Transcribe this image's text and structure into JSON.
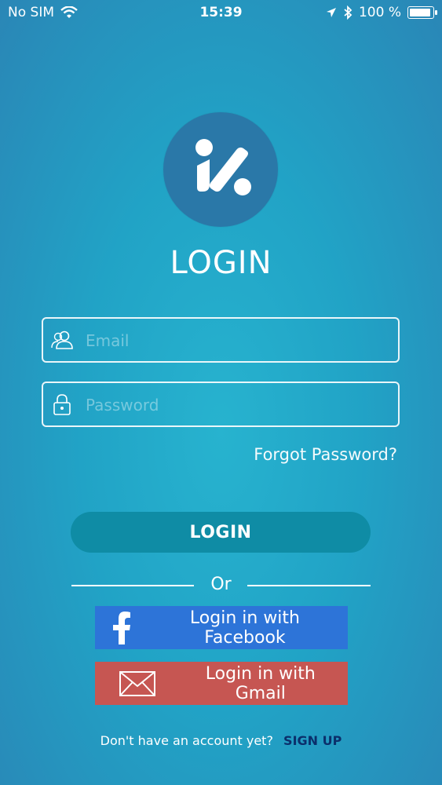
{
  "status_bar": {
    "carrier": "No SIM",
    "time": "15:39",
    "battery": "100 %",
    "battery_level": 1.0,
    "icons": [
      "wifi-icon",
      "location-arrow-icon",
      "bluetooth-icon",
      "battery-icon"
    ]
  },
  "login_form": {
    "title": "LOGIN",
    "email_placeholder": "Email",
    "password_placeholder": "Password",
    "forgot_password": "Forgot Password?",
    "submit_label": "LOGIN",
    "or_label": "Or"
  },
  "social_login": {
    "facebook_label": "Login in with Facebook",
    "gmail_label": "Login in with Gmail"
  },
  "footer": {
    "prompt": "Don't have an account yet?",
    "signup_label": "SIGN UP"
  },
  "colors": {
    "background": "#22a6c7",
    "login_button": "#0f8ca5",
    "facebook": "#2d74d8",
    "gmail": "#c65652",
    "signup_link": "#0b2f6b"
  }
}
